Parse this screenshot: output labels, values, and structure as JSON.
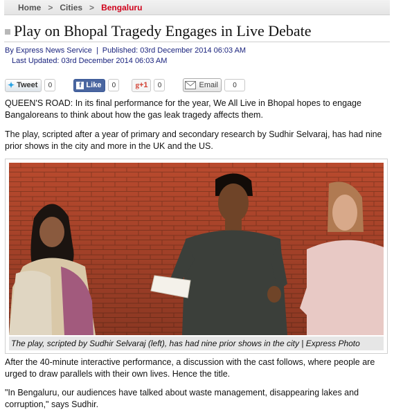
{
  "breadcrumb": {
    "home": "Home",
    "sep1": ">",
    "section": "Cities",
    "sep2": ">",
    "current": "Bengaluru"
  },
  "article": {
    "title": "Play on Bhopal Tragedy Engages in Live Debate",
    "byline": "By Express News Service",
    "published": "Published: 03rd December 2014 06:03 AM",
    "updated": "Last Updated: 03rd December 2014 06:03 AM",
    "meta_sep": "|",
    "paragraphs": [
      "QUEEN'S ROAD: In its final performance for the year, We All Live in Bhopal hopes to engage Bangaloreans to think about how the gas leak tragedy affects them.",
      "The play, scripted after a year of primary and secondary research by Sudhir Selvaraj, has had nine prior shows in the city and more in the UK and the US.",
      "After the 40-minute interactive performance, a discussion with the cast follows, where people are urged to draw parallels with their own lives. Hence the title.",
      "\"In Bengaluru, our audiences have talked about waste management, disappearing lakes and corruption,\" says Sudhir."
    ],
    "caption": "The play, scripted by Sudhir Selvaraj (left), has had nine prior shows in the city | Express Photo"
  },
  "share": {
    "tweet_label": "Tweet",
    "tweet_count": "0",
    "like_label": "Like",
    "like_count": "0",
    "gplus_label": "+1",
    "gplus_count": "0",
    "email_label": "Email",
    "email_count": "0"
  },
  "icons": {
    "tweet": "bird-icon",
    "like": "facebook-icon",
    "gplus": "google-plus-icon",
    "email": "envelope-icon"
  },
  "colors": {
    "breadcrumb_current": "#d0021b",
    "meta_text": "#1a237e",
    "facebook": "#4a66a0",
    "photo_wall": "#b5472c"
  }
}
